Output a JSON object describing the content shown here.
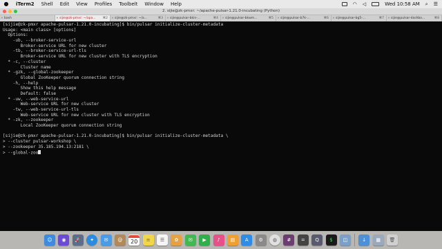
{
  "menubar": {
    "app": "iTerm2",
    "items": [
      "Shell",
      "Edit",
      "View",
      "Profiles",
      "Toolbelt",
      "Window",
      "Help"
    ],
    "clock": "Wed 10:58 AM"
  },
  "window": {
    "title": "2. sijie@zk-pmxr: ~/apache-pulsar-1.21.0-incubating (Python)"
  },
  "tabs": [
    {
      "label": "bash",
      "number": ""
    },
    {
      "label": "sijie@zk-pmxr: ~/apa...",
      "number": "⌘2"
    },
    {
      "label": "sijie@zk-pmxr: ~/a...",
      "number": "⌘3"
    },
    {
      "label": "sijie@pulsar-bkin-...",
      "number": "⌘4"
    },
    {
      "label": "sijie@pulsar-bkwm...",
      "number": "⌘5"
    },
    {
      "label": "sijie@pulsar-b7k-...",
      "number": "⌘6"
    },
    {
      "label": "sijie@pulsar-bg5-...",
      "number": "⌘7"
    },
    {
      "label": "sijie@pulsar-dashbo...",
      "number": "⌘8"
    }
  ],
  "terminal": {
    "lines": [
      "[sijie@zk-pmxr apache-pulsar-1.21.0-incubating]$ bin/pulsar initialize-cluster-metadata",
      "Usage: <main class> [options]",
      "  Options:",
      "    -ub, --broker-service-url",
      "       Broker-service URL for new cluster",
      "    -tb, --broker-service-url-tls",
      "       Broker-service URL for new cluster with TLS encryption",
      "  * -c, --cluster",
      "       Cluster name",
      "  * -gzk, --global-zookeeper",
      "       Global ZooKeeper quorum connection string",
      "    -h, --help",
      "       Show this help message",
      "       Default: false",
      "  * -uw, --web-service-url",
      "       Web-service URL for new cluster",
      "    -tw, --web-service-url-tls",
      "       Web-service URL for new cluster with TLS encryption",
      "  * -zk, --zookeeper",
      "       Local ZooKeeper quorum connection string",
      "",
      "[sijie@zk-pmxr apache-pulsar-1.21.0-incubating]$ bin/pulsar initialize-cluster-metadata \\",
      "> --cluster pulsar-workshop \\",
      "> --zookeeper 35.185.194.13:2181 \\",
      "> --global-zoo"
    ]
  },
  "dock": {
    "calendar_day": "20",
    "icons": [
      {
        "name": "finder-icon",
        "color": "#3d8be0",
        "glyph": "☺"
      },
      {
        "name": "siri-icon",
        "color": "#6a4bd1",
        "glyph": "◉"
      },
      {
        "name": "launchpad-icon",
        "color": "#5b6e8a",
        "glyph": "🚀"
      },
      {
        "name": "safari-icon",
        "color": "#2a8be0",
        "glyph": "✦"
      },
      {
        "name": "mail-icon",
        "color": "#4a9be8",
        "glyph": "✉"
      },
      {
        "name": "contacts-icon",
        "color": "#b08a5a",
        "glyph": "@"
      },
      {
        "name": "calendar-icon",
        "color": "#ffffff",
        "glyph": ""
      },
      {
        "name": "notes-icon",
        "color": "#f2d64a",
        "glyph": "≡"
      },
      {
        "name": "reminders-icon",
        "color": "#f5f5f5",
        "glyph": "☰"
      },
      {
        "name": "photos-icon",
        "color": "#e8a040",
        "glyph": "✿"
      },
      {
        "name": "messages-icon",
        "color": "#3fb950",
        "glyph": "✉"
      },
      {
        "name": "facetime-icon",
        "color": "#2fae4a",
        "glyph": "▶"
      },
      {
        "name": "music-icon",
        "color": "#e8508a",
        "glyph": "♪"
      },
      {
        "name": "ibooks-icon",
        "color": "#f0a030",
        "glyph": "▤"
      },
      {
        "name": "app-store-icon",
        "color": "#2d8ce8",
        "glyph": "A"
      },
      {
        "name": "system-preferences-icon",
        "color": "#8a8a8a",
        "glyph": "⚙"
      },
      {
        "name": "chrome-icon",
        "color": "#e0e0e0",
        "glyph": "◍"
      },
      {
        "name": "slack-icon",
        "color": "#6a3f6f",
        "glyph": "#"
      },
      {
        "name": "calculator-icon",
        "color": "#444",
        "glyph": "="
      },
      {
        "name": "quicktime-icon",
        "color": "#5a5a6e",
        "glyph": "Q"
      },
      {
        "name": "iterm-icon",
        "color": "#1a1a1a",
        "glyph": "$"
      },
      {
        "name": "preview-icon",
        "color": "#7aa0c8",
        "glyph": "◫"
      },
      {
        "name": "downloads-icon",
        "color": "#4d90d8",
        "glyph": "↓"
      },
      {
        "name": "documents-icon",
        "color": "#9aa9bc",
        "glyph": "▦"
      },
      {
        "name": "trash-icon",
        "color": "#d0d0d0",
        "glyph": "🗑"
      }
    ]
  }
}
